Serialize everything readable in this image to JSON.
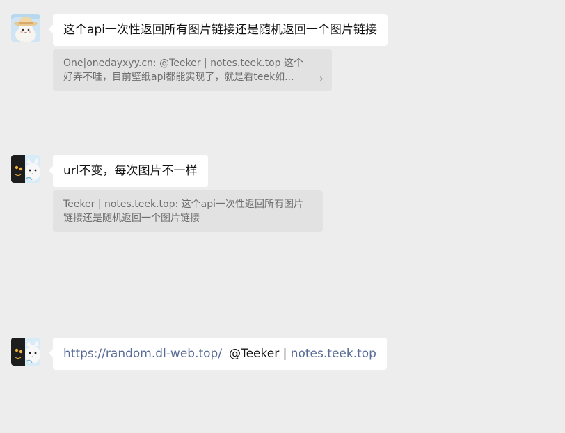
{
  "messages": [
    {
      "avatar": "sun-hat-avatar-icon",
      "text": "这个api一次性返回所有图片链接还是随机返回一个图片链接",
      "quote": {
        "line1": "One|onedayxyy.cn: @Teeker | notes.teek.top 这个",
        "line2": "好弄不哇，目前壁纸api都能实现了，就是看teek如...",
        "more_icon": "chevron-right-icon"
      }
    },
    {
      "avatar": "black-white-cat-avatar-icon",
      "text": "url不变，每次图片不一样",
      "quote": {
        "line1": "Teeker | notes.teek.top: 这个api一次性返回所有图片",
        "line2": "链接还是随机返回一个图片链接"
      }
    },
    {
      "avatar": "black-white-cat-avatar-icon",
      "link": "https://random.dl-web.top/",
      "mention": "@Teeker | ",
      "site": "notes.teek.top"
    }
  ],
  "colors": {
    "background": "#ededed",
    "bubble": "#ffffff",
    "quote": "#e2e2e2",
    "link": "#576b95"
  }
}
